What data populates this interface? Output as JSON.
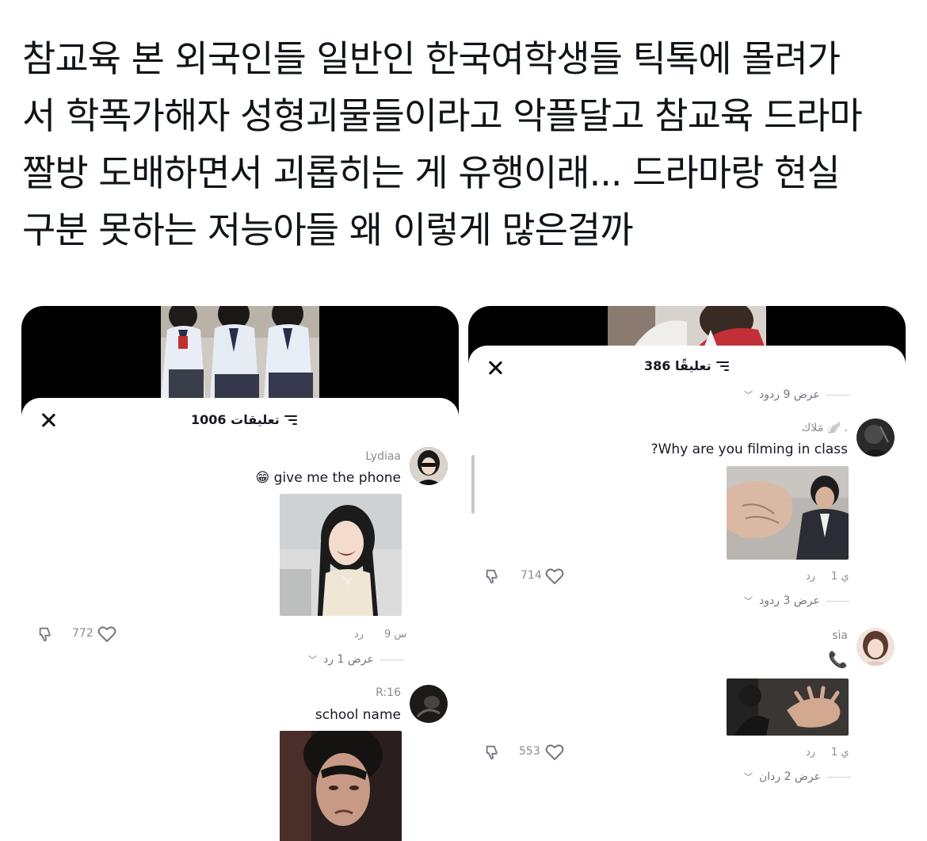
{
  "post": {
    "lines": [
      "참교육 본 외국인들 일반인 한국여학생들 틱톡에 몰려가",
      "서 학폭가해자 성형괴물들이라고 악플달고 참교육 드라마",
      "짤방 도배하면서 괴롭히는 게 유행이래... 드라마랑 현실",
      "구분 못하는 저능아들 왜 이렇게 많은걸까"
    ]
  },
  "left_screenshot": {
    "comment_count_title": "1006 تعليقات",
    "comments": [
      {
        "username": "Lydiaa",
        "text": "give me the phone",
        "emoji": "😁",
        "time": "9 س",
        "reply_label": "رد",
        "likes": "772",
        "view_replies": "عرض 1 رد"
      },
      {
        "username": "R:16",
        "text": "school name"
      }
    ]
  },
  "right_screenshot": {
    "comment_count_title": "386 تعليقًا",
    "top_view_replies": "عرض 9 ردود",
    "comments": [
      {
        "username": "مَلاك 🪽 .",
        "text": "?Why are you filming in class",
        "time": "1 ي",
        "reply_label": "رد",
        "likes": "714",
        "view_replies": "عرض 3 ردود"
      },
      {
        "username": "sia",
        "text": "📞",
        "time": "1 ي",
        "reply_label": "رد",
        "likes": "553",
        "view_replies": "عرض 2 ردان"
      }
    ]
  },
  "icons": {
    "close": "close-icon",
    "filter": "filter-icon",
    "heart": "heart-icon",
    "dislike": "dislike-icon",
    "chevron": "chevron-down-icon"
  },
  "colors": {
    "panel_bg": "#ffffff",
    "muted_text": "#8a8b91",
    "primary_text": "#161823",
    "video_bg": "#000000"
  }
}
